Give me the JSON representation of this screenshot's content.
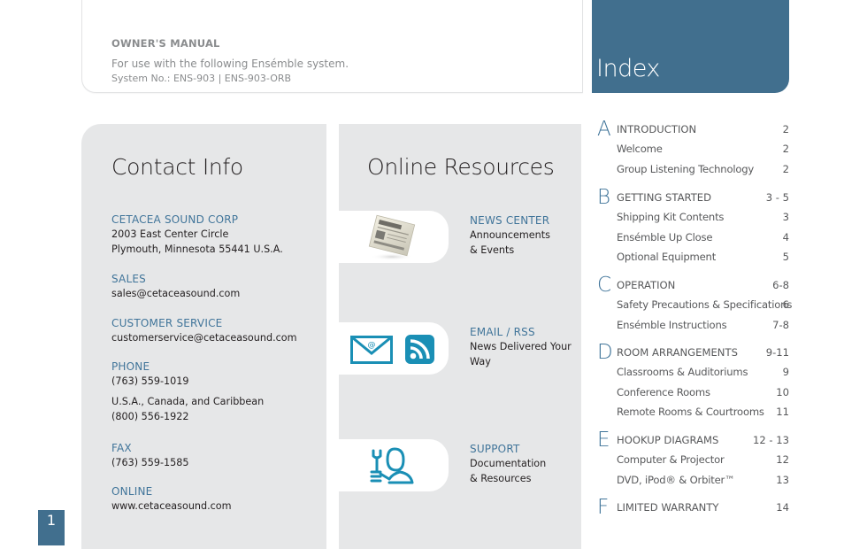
{
  "header": {
    "title": "OWNER'S MANUAL",
    "subtitle": "For use with the following Ensémble system.",
    "system_numbers": "System No.:  ENS-903  |  ENS-903-ORB"
  },
  "index_header": {
    "title": "Index"
  },
  "contact": {
    "title": "Contact Info",
    "sections": [
      {
        "label": "CETACEA SOUND CORP",
        "lines": [
          "2003 East Center Circle",
          "Plymouth, Minnesota  55441 U.S.A."
        ]
      },
      {
        "label": "SALES",
        "lines": [
          "sales@cetaceasound.com"
        ]
      },
      {
        "label": "CUSTOMER SERVICE",
        "lines": [
          "customerservice@cetaceasound.com"
        ]
      },
      {
        "label": "PHONE",
        "lines": [
          "(763) 559-1019"
        ],
        "extra": [
          "U.S.A., Canada, and Caribbean",
          "(800) 556-1922"
        ]
      },
      {
        "label": "FAX",
        "lines": [
          "(763) 559-1585"
        ]
      },
      {
        "label": "ONLINE",
        "lines": [
          "www.cetaceasound.com"
        ]
      }
    ]
  },
  "online": {
    "title": "Online Resources",
    "resources": [
      {
        "label": "NEWS CENTER",
        "desc_1": "Announcements",
        "desc_2": "& Events",
        "icon": "newspaper-icon"
      },
      {
        "label": "EMAIL / RSS",
        "desc_1": "News Delivered Your",
        "desc_2": "Way",
        "icon": "email-rss-icon"
      },
      {
        "label": "SUPPORT",
        "desc_1": "Documentation",
        "desc_2": "& Resources",
        "icon": "support-icon"
      }
    ]
  },
  "index": [
    {
      "letter": "A",
      "entries": [
        {
          "text": "INTRODUCTION",
          "page": "2",
          "main": true
        },
        {
          "text": "Welcome",
          "page": "2"
        },
        {
          "text": "Group Listening Technology",
          "page": "2"
        }
      ]
    },
    {
      "letter": "B",
      "entries": [
        {
          "text": "GETTING STARTED",
          "page": "3 - 5",
          "main": true
        },
        {
          "text": "Shipping Kit Contents",
          "page": "3"
        },
        {
          "text": "Ensémble Up Close",
          "page": "4"
        },
        {
          "text": "Optional Equipment",
          "page": "5"
        }
      ]
    },
    {
      "letter": "C",
      "entries": [
        {
          "text": "OPERATION",
          "page": "6-8",
          "main": true
        },
        {
          "text": "Safety Precautions & Specifications",
          "page": "6"
        },
        {
          "text": "Ensémble Instructions",
          "page": "7-8"
        }
      ]
    },
    {
      "letter": "D",
      "entries": [
        {
          "text": "ROOM ARRANGEMENTS",
          "page": "9-11",
          "main": true
        },
        {
          "text": "Classrooms & Auditoriums",
          "page": "9"
        },
        {
          "text": "Conference Rooms",
          "page": "10"
        },
        {
          "text": "Remote Rooms & Courtrooms",
          "page": "11"
        }
      ]
    },
    {
      "letter": "E",
      "entries": [
        {
          "text": "HOOKUP DIAGRAMS",
          "page": "12 - 13",
          "main": true
        },
        {
          "text": "Computer & Projector",
          "page": "12"
        },
        {
          "text": "DVD, iPod® & Orbiter™",
          "page": "13"
        }
      ]
    },
    {
      "letter": "F",
      "entries": [
        {
          "text": "LIMITED WARRANTY",
          "page": "14",
          "main": true
        }
      ]
    }
  ],
  "page_number": "1",
  "colors": {
    "accent": "#416f8e",
    "label_blue": "#41759a",
    "icon_teal": "#1a8fb5",
    "panel_gray": "#e6e7e8"
  }
}
